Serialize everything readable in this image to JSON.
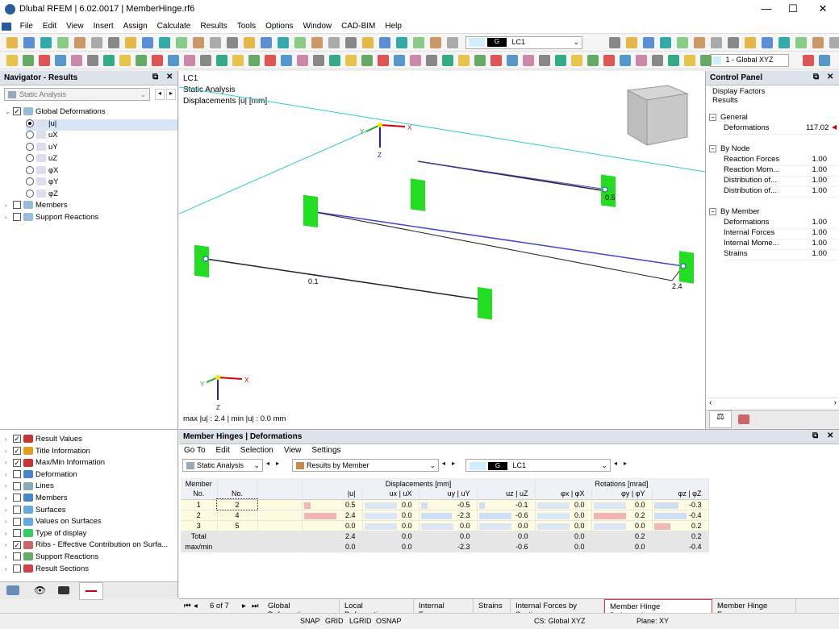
{
  "app": {
    "title": "Dlubal RFEM | 6.02.0017 | MemberHinge.rf6",
    "win_min": "—",
    "win_max": "☐",
    "win_close": "✕"
  },
  "menu": [
    "File",
    "Edit",
    "View",
    "Insert",
    "Assign",
    "Calculate",
    "Results",
    "Tools",
    "Options",
    "Window",
    "CAD-BIM",
    "Help"
  ],
  "toolbar": {
    "lc_code": "G",
    "lc_name": "LC1",
    "cs": "1 - Global XYZ"
  },
  "navigator": {
    "title": "Navigator - Results",
    "combo": "Static Analysis",
    "tree": [
      {
        "label": "Global Deformations",
        "level": 0,
        "ctrl": "check",
        "on": true
      },
      {
        "label": "|u|",
        "level": 1,
        "ctrl": "radio",
        "on": true,
        "sel": true
      },
      {
        "label": "uX",
        "level": 1,
        "ctrl": "radio",
        "on": false
      },
      {
        "label": "uY",
        "level": 1,
        "ctrl": "radio",
        "on": false
      },
      {
        "label": "uZ",
        "level": 1,
        "ctrl": "radio",
        "on": false
      },
      {
        "label": "φX",
        "level": 1,
        "ctrl": "radio",
        "on": false
      },
      {
        "label": "φY",
        "level": 1,
        "ctrl": "radio",
        "on": false
      },
      {
        "label": "φZ",
        "level": 1,
        "ctrl": "radio",
        "on": false
      },
      {
        "label": "Members",
        "level": 0,
        "ctrl": "check",
        "on": false
      },
      {
        "label": "Support Reactions",
        "level": 0,
        "ctrl": "check",
        "on": false
      }
    ],
    "options": [
      {
        "label": "Result Values",
        "on": true
      },
      {
        "label": "Title Information",
        "on": true
      },
      {
        "label": "Max/Min Information",
        "on": true
      },
      {
        "label": "Deformation",
        "on": false
      },
      {
        "label": "Lines",
        "on": false
      },
      {
        "label": "Members",
        "on": false
      },
      {
        "label": "Surfaces",
        "on": false
      },
      {
        "label": "Values on Surfaces",
        "on": false
      },
      {
        "label": "Type of display",
        "on": false
      },
      {
        "label": "Ribs - Effective Contribution on Surfa...",
        "on": true
      },
      {
        "label": "Support Reactions",
        "on": false
      },
      {
        "label": "Result Sections",
        "on": false
      }
    ]
  },
  "view": {
    "line1": "LC1",
    "line2": "Static Analysis",
    "line3": "Displacements |u| [mm]",
    "maxmin": "max |u| : 2.4 | min |u| : 0.0 mm",
    "lbl_a": "0.5",
    "lbl_b": "2.4",
    "lbl_c": "0.1",
    "axis_x": "X",
    "axis_y": "Y",
    "axis_z": "Z"
  },
  "control_panel": {
    "title": "Control Panel",
    "h1": "Display Factors",
    "h2": "Results",
    "groups": [
      {
        "name": "General",
        "items": [
          {
            "k": "Deformations",
            "v": "117.02"
          }
        ]
      },
      {
        "name": "By Node",
        "items": [
          {
            "k": "Reaction Forces",
            "v": "1.00"
          },
          {
            "k": "Reaction Mom...",
            "v": "1.00"
          },
          {
            "k": "Distribution of...",
            "v": "1.00"
          },
          {
            "k": "Distribution of...",
            "v": "1.00"
          }
        ]
      },
      {
        "name": "By Member",
        "items": [
          {
            "k": "Deformations",
            "v": "1.00"
          },
          {
            "k": "Internal Forces",
            "v": "1.00"
          },
          {
            "k": "Internal Mome...",
            "v": "1.00"
          },
          {
            "k": "Strains",
            "v": "1.00"
          }
        ]
      }
    ]
  },
  "table_panel": {
    "title": "Member Hinges | Deformations",
    "menu": [
      "Go To",
      "Edit",
      "Selection",
      "View",
      "Settings"
    ],
    "combo1": "Static Analysis",
    "combo2": "Results by Member",
    "lc_code": "G",
    "lc_name": "LC1",
    "hdr_member": "Member",
    "hdr_member2": "No.",
    "hdr_no": "No.",
    "hdr_disp": "Displacements [mm]",
    "hdr_rot": "Rotations [mrad]",
    "cols": [
      "|u|",
      "ux | uX",
      "uy | uY",
      "uz | uZ",
      "φx | φX",
      "φy | φY",
      "φz | φZ"
    ],
    "rows": [
      {
        "m": "1",
        "n": "2",
        "v": [
          "0.5",
          "0.0",
          "-0.5",
          "-0.1",
          "0.0",
          "0.0",
          "-0.3"
        ]
      },
      {
        "m": "2",
        "n": "4",
        "v": [
          "2.4",
          "0.0",
          "-2.3",
          "-0.6",
          "0.0",
          "0.2",
          "-0.4"
        ]
      },
      {
        "m": "3",
        "n": "5",
        "v": [
          "0.0",
          "0.0",
          "0.0",
          "0.0",
          "0.0",
          "0.0",
          "0.2"
        ]
      },
      {
        "m": "Total",
        "n": "",
        "v": [
          "2.4",
          "0.0",
          "0.0",
          "0.0",
          "0.0",
          "0.2",
          "0.2"
        ]
      },
      {
        "m": "max/min",
        "n": "",
        "v": [
          "0.0",
          "0.0",
          "-2.3",
          "-0.6",
          "0.0",
          "0.0",
          "-0.4"
        ]
      }
    ],
    "pager": "6 of 7",
    "tabs": [
      "Global Deformations",
      "Local Deformations",
      "Internal Forces",
      "Strains",
      "Internal Forces by Section",
      "Member Hinge Deformations",
      "Member Hinge Forces"
    ]
  },
  "status": {
    "items": [
      "SNAP",
      "GRID",
      "LGRID",
      "OSNAP"
    ],
    "cs": "CS: Global XYZ",
    "plane": "Plane: XY"
  }
}
